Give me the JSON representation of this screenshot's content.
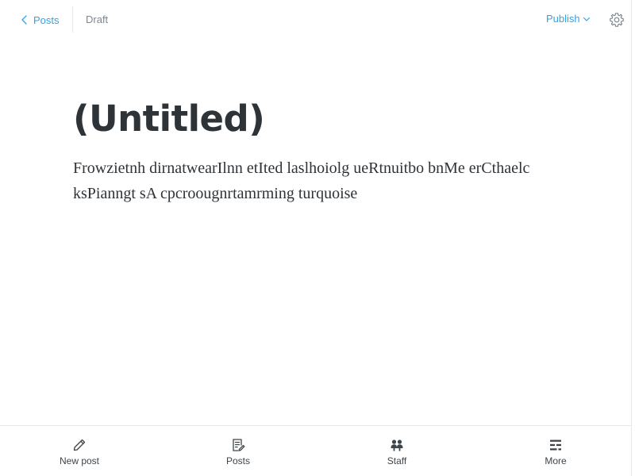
{
  "header": {
    "back_label": "Posts",
    "status": "Draft",
    "publish_label": "Publish"
  },
  "editor": {
    "title": "(Untitled)",
    "body": "Frowzietnh dirnatwearIlnn etIted laslhoiolg ueRtnuitbo bnMe erCthaelc ksPianngt sA cpcroougnrtamrming turquoise"
  },
  "bottom_nav": {
    "items": [
      {
        "label": "New post",
        "icon": "pencil-icon"
      },
      {
        "label": "Posts",
        "icon": "posts-icon"
      },
      {
        "label": "Staff",
        "icon": "staff-icon"
      },
      {
        "label": "More",
        "icon": "more-icon"
      }
    ]
  },
  "colors": {
    "accent": "#2fa4e7",
    "text_dark": "#2e3338",
    "text_muted": "#7d8790",
    "border": "#e5e8eb"
  }
}
